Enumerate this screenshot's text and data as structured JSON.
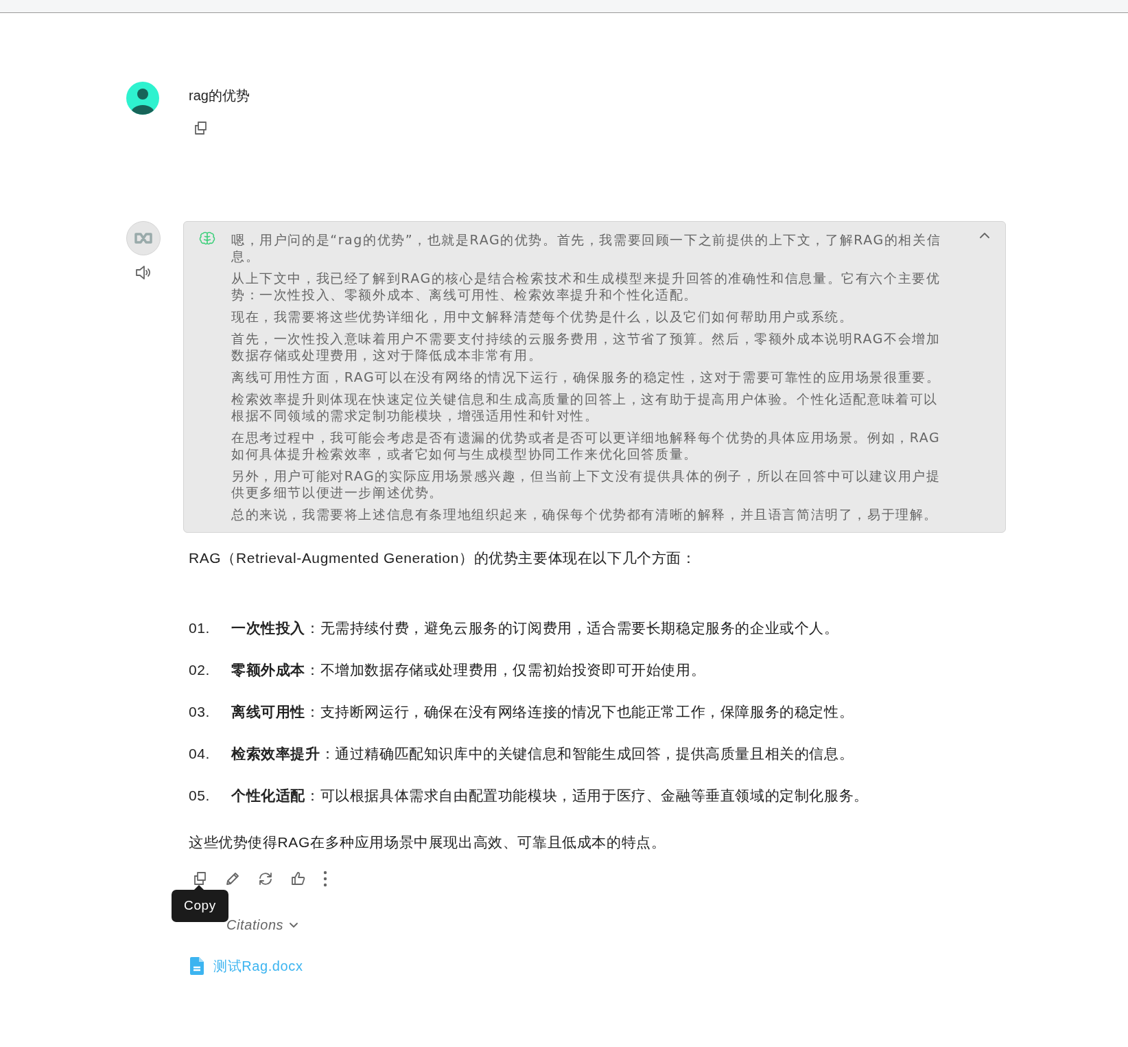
{
  "user_message": {
    "text": "rag的优势"
  },
  "thinking": {
    "expanded": true,
    "paragraphs": [
      "嗯，用户问的是“rag的优势”，也就是RAG的优势。首先，我需要回顾一下之前提供的上下文，了解RAG的相关信息。",
      "从上下文中，我已经了解到RAG的核心是结合检索技术和生成模型来提升回答的准确性和信息量。它有六个主要优势：一次性投入、零额外成本、离线可用性、检索效率提升和个性化适配。",
      "现在，我需要将这些优势详细化，用中文解释清楚每个优势是什么，以及它们如何帮助用户或系统。",
      "首先，一次性投入意味着用户不需要支付持续的云服务费用，这节省了预算。然后，零额外成本说明RAG不会增加数据存储或处理费用，这对于降低成本非常有用。",
      "离线可用性方面，RAG可以在没有网络的情况下运行，确保服务的稳定性，这对于需要可靠性的应用场景很重要。",
      "检索效率提升则体现在快速定位关键信息和生成高质量的回答上，这有助于提高用户体验。个性化适配意味着可以根据不同领域的需求定制功能模块，增强适用性和针对性。",
      "在思考过程中，我可能会考虑是否有遗漏的优势或者是否可以更详细地解释每个优势的具体应用场景。例如，RAG如何具体提升检索效率，或者它如何与生成模型协同工作来优化回答质量。",
      "另外，用户可能对RAG的实际应用场景感兴趣，但当前上下文没有提供具体的例子，所以在回答中可以建议用户提供更多细节以便进一步阐述优势。",
      "总的来说，我需要将上述信息有条理地组织起来，确保每个优势都有清晰的解释，并且语言简洁明了，易于理解。"
    ]
  },
  "answer": {
    "intro": "RAG（Retrieval-Augmented Generation）的优势主要体现在以下几个方面：",
    "items": [
      {
        "number": "01.",
        "text": "**一次性投入**：无需持续付费，避免云服务的订阅费用，适合需要长期稳定服务的企业或个人。"
      },
      {
        "number": "02.",
        "text": "**零额外成本**：不增加数据存储或处理费用，仅需初始投资即可开始使用。"
      },
      {
        "number": "03.",
        "text": "**离线可用性**：支持断网运行，确保在没有网络连接的情况下也能正常工作，保障服务的稳定性。"
      },
      {
        "number": "04.",
        "text": "**检索效率提升**：通过精确匹配知识库中的关键信息和智能生成回答，提供高质量且相关的信息。"
      },
      {
        "number": "05.",
        "text": "**个性化适配**：可以根据具体需求自由配置功能模块，适用于医疗、金融等垂直领域的定制化服务。"
      }
    ],
    "summary": "这些优势使得RAG在多种应用场景中展现出高效、可靠且低成本的特点。"
  },
  "tooltip": {
    "text": "Copy"
  },
  "citations": {
    "toggle": "Citations",
    "files": [
      "测试Rag.docx"
    ]
  }
}
